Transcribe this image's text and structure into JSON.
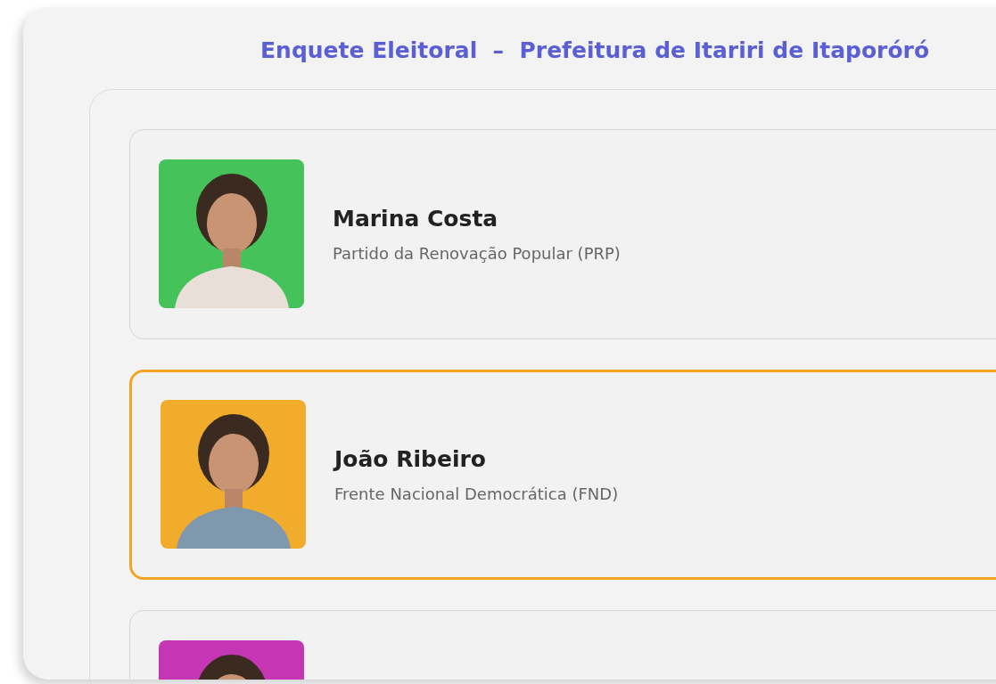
{
  "title": "Enquete Eleitoral  –  Prefeitura de Itariri de Itaporóró",
  "candidates": [
    {
      "name": "Marina Costa",
      "party": "Partido da Renovação Popular (PRP)",
      "color": "#45c35a",
      "selected": false
    },
    {
      "name": "João Ribeiro",
      "party": "Frente Nacional Democrática (FND)",
      "color": "#f2ac2c",
      "selected": true
    },
    {
      "color": "#c436b4",
      "selected": false
    }
  ]
}
